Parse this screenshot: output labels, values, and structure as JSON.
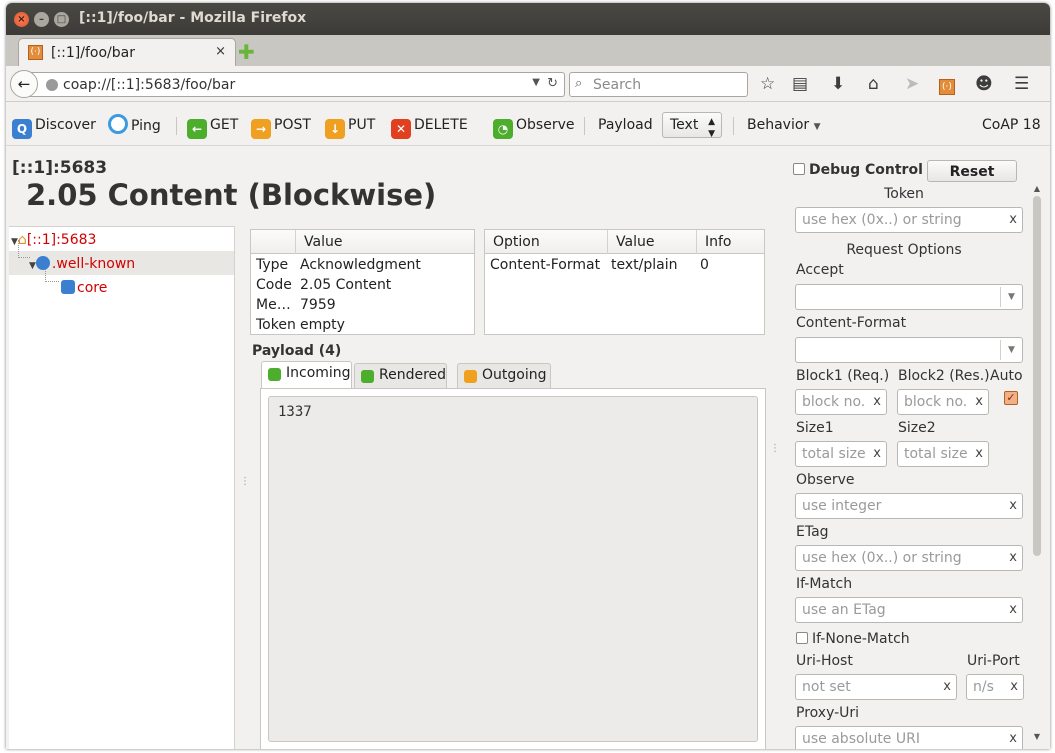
{
  "window": {
    "title": "[::1]/foo/bar - Mozilla Firefox"
  },
  "tab": {
    "label": "[::1]/foo/bar",
    "close": "×",
    "new_tab": "✚"
  },
  "nav": {
    "url": "coap://[::1]:5683/foo/bar",
    "search_placeholder": "Search",
    "icons": [
      "star-icon",
      "reading-list-icon",
      "download-icon",
      "home-icon",
      "send-icon",
      "copper-icon",
      "chat-icon",
      "menu-icon"
    ]
  },
  "toolbar": {
    "discover": "Discover",
    "ping": "Ping",
    "get": "GET",
    "post": "POST",
    "put": "PUT",
    "delete": "DELETE",
    "observe": "Observe",
    "payload": "Payload",
    "payload_type": "Text",
    "behavior": "Behavior",
    "version": "CoAP 18"
  },
  "header": {
    "host": "[::1]:5683",
    "status": "2.05 Content (Blockwise)"
  },
  "tree": {
    "root": "[::1]:5683",
    "child": ".well-known",
    "leaf": "core"
  },
  "message_table": {
    "col_value": "Value",
    "rows": [
      {
        "key": "Type",
        "value": "Acknowledgment"
      },
      {
        "key": "Code",
        "value": "2.05 Content"
      },
      {
        "key": "Me…",
        "value": "7959"
      },
      {
        "key": "Token",
        "value": "empty"
      }
    ]
  },
  "options_table": {
    "headers": [
      "Option",
      "Value",
      "Info"
    ],
    "rows": [
      {
        "option": "Content-Format",
        "value": "text/plain",
        "info": "0"
      }
    ]
  },
  "payload": {
    "label": "Payload (4)",
    "tabs": [
      "Incoming",
      "Rendered",
      "Outgoing"
    ],
    "content": "1337"
  },
  "right_panel": {
    "debug_control": "Debug Control",
    "reset": "Reset",
    "token_label": "Token",
    "token_placeholder": "use hex (0x..) or string",
    "request_options": "Request Options",
    "accept": "Accept",
    "content_format": "Content-Format",
    "block1": "Block1 (Req.)",
    "block2": "Block2 (Res.)",
    "auto": "Auto",
    "block_placeholder": "block no.",
    "size1": "Size1",
    "size2": "Size2",
    "size_placeholder": "total size",
    "observe": "Observe",
    "observe_placeholder": "use integer",
    "etag": "ETag",
    "etag_placeholder": "use hex (0x..) or string",
    "if_match": "If-Match",
    "if_match_placeholder": "use an ETag",
    "if_none_match": "If-None-Match",
    "uri_host": "Uri-Host",
    "uri_host_placeholder": "not set",
    "uri_port": "Uri-Port",
    "uri_port_placeholder": "n/s",
    "proxy_uri": "Proxy-Uri",
    "proxy_uri_placeholder": "use absolute URI",
    "clear": "x"
  },
  "colors": {
    "accent_red": "#d40000",
    "titlebar": "#3c3b37"
  }
}
